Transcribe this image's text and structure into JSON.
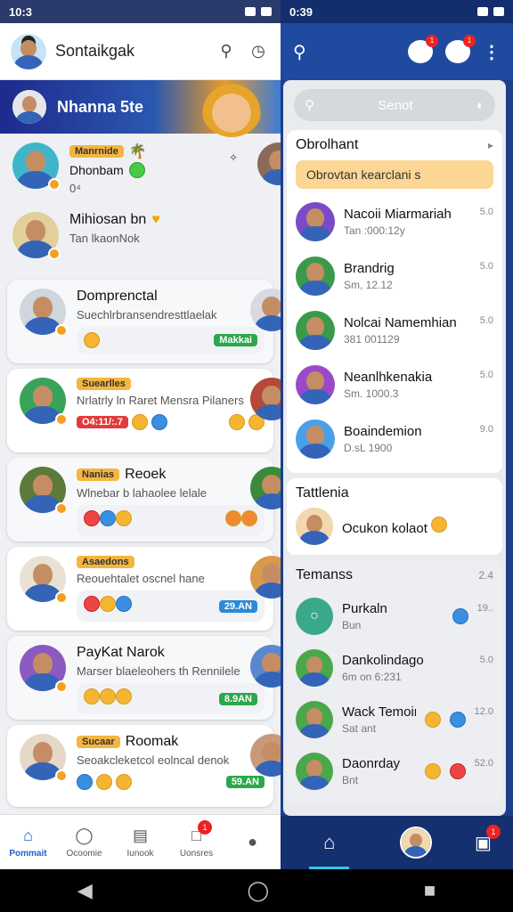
{
  "left": {
    "status_time": "10:3",
    "app_title": "Sontaikgak",
    "banner_title": "Nhanna 5te",
    "chats": [
      {
        "tag": "Manrnide",
        "name": "Dhonbam",
        "sub": "0⁴",
        "style": "none"
      },
      {
        "tag": "",
        "name": "Mihiosan bn",
        "sub": "Tan lkaonNok",
        "style": "none"
      },
      {
        "tag": "",
        "name": "Domprenctal",
        "sub": "Suechlrbransendresttlaelak",
        "pill": "Makkai",
        "pill_color": "green",
        "style": "plain"
      },
      {
        "tag": "Suearlles",
        "name": "",
        "sub": "Nrlatrly ln Raret Mensra Pilaners",
        "pill": "O4:11/:.7",
        "pill_color": "red",
        "style": "card"
      },
      {
        "tag": "Nanias",
        "name": "Reoek",
        "sub": "Wlnebar b lahaolee lelale",
        "pill": "",
        "pill_color": "",
        "style": "plain"
      },
      {
        "tag": "Asaedons",
        "name": "",
        "sub": "Reouehtalet oscnel hane",
        "pill": "29.AN",
        "pill_color": "blue",
        "style": "card"
      },
      {
        "tag": "",
        "name": "PayKat Narok",
        "sub": "Marser blaeleohers th Rennilele",
        "pill": "8.9AN",
        "pill_color": "green",
        "style": "plain"
      },
      {
        "tag": "Sucaar",
        "name": "Roomak",
        "sub": "Seoakcleketcol eolncal denok",
        "pill": "59.AN",
        "pill_color": "green",
        "style": "card"
      }
    ],
    "nav": [
      {
        "label": "Pommait",
        "icon": "home-icon",
        "active": true
      },
      {
        "label": "Ocoomie",
        "icon": "people-icon",
        "active": false
      },
      {
        "label": "Iunook",
        "icon": "book-icon",
        "active": false
      },
      {
        "label": "Uonsres",
        "icon": "chat-icon",
        "active": false,
        "badge": "1"
      },
      {
        "label": "",
        "icon": "lock-icon",
        "active": false
      }
    ]
  },
  "right": {
    "status_time": "0:39",
    "search_placeholder": "Senot",
    "section1_title": "Obrolhant",
    "alert_text": "Obrovtan kearclani s",
    "contacts": [
      {
        "name": "Nacoii Miarmariah",
        "sub": "Tan :000:12y",
        "time": "5.0"
      },
      {
        "name": "Brandrig",
        "sub": "Sm, 12.12",
        "time": "5.0"
      },
      {
        "name": "Nolcai Namemhian",
        "sub": "381 001129",
        "time": "5.0"
      },
      {
        "name": "Neanlhkenakia",
        "sub": "Sm. 1000.3",
        "time": "5.0"
      },
      {
        "name": "Boaindemion",
        "sub": "D.sL 1900",
        "time": "9.0"
      }
    ],
    "section2_title": "Tattlenia",
    "section2_item": "Ocukon kolaot",
    "section3_title": "Temanss",
    "section3_count": "2.4",
    "friends": [
      {
        "name": "Purkaln",
        "sub": "Bun",
        "time": "19.."
      },
      {
        "name": "Dankolindago",
        "sub": "6m on 6:231",
        "time": "5.0"
      },
      {
        "name": "Wack Temoin",
        "sub": "Sat ant",
        "time": "12.0"
      },
      {
        "name": "Daonrday",
        "sub": "Bnt",
        "time": "52.0"
      }
    ],
    "badge_count": "1"
  }
}
